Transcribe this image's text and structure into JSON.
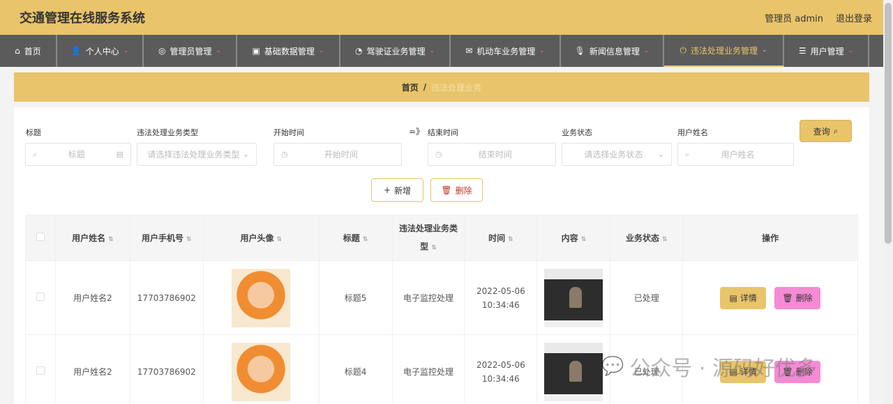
{
  "header": {
    "title": "交通管理在线服务系统",
    "user": "管理员 admin",
    "logout": "退出登录"
  },
  "nav": [
    {
      "label": "首页",
      "icon": "home-icon",
      "chevron": false
    },
    {
      "label": "个人中心",
      "icon": "user-icon",
      "chevron": true
    },
    {
      "label": "管理员管理",
      "icon": "admin-icon",
      "chevron": true
    },
    {
      "label": "基础数据管理",
      "icon": "data-icon",
      "chevron": true
    },
    {
      "label": "驾驶证业务管理",
      "icon": "license-icon",
      "chevron": true
    },
    {
      "label": "机动车业务管理",
      "icon": "mail-icon",
      "chevron": true
    },
    {
      "label": "新闻信息管理",
      "icon": "mic-icon",
      "chevron": true
    },
    {
      "label": "违法处理业务管理",
      "icon": "power-icon",
      "chevron": true,
      "active": true
    },
    {
      "label": "用户管理",
      "icon": "list-icon",
      "chevron": true
    }
  ],
  "breadcrumb": {
    "home": "首页",
    "sep": "/",
    "current": "违法处理业务"
  },
  "filters": {
    "title_label": "标题",
    "title_placeholder": "标题",
    "type_label": "违法处理业务类型",
    "type_placeholder": "请选择违法处理业务类型",
    "start_label": "开始时间",
    "start_placeholder": "开始时间",
    "range_sep": "=》",
    "end_label": "结束时间",
    "end_placeholder": "结束时间",
    "status_label": "业务状态",
    "status_placeholder": "请选择业务状态",
    "username_label": "用户姓名",
    "username_placeholder": "用户姓名",
    "query": "查询"
  },
  "actions": {
    "add": "新增",
    "delete": "删除"
  },
  "table": {
    "headers": [
      "用户姓名",
      "用户手机号",
      "用户头像",
      "标题",
      "违法处理业务类型",
      "时间",
      "内容",
      "业务状态",
      "操作"
    ],
    "rows": [
      {
        "name": "用户姓名2",
        "phone": "17703786902",
        "title": "标题5",
        "type": "电子监控处理",
        "time": "2022-05-06 10:34:46",
        "status": "已处理"
      },
      {
        "name": "用户姓名2",
        "phone": "17703786902",
        "title": "标题4",
        "type": "电子监控处理",
        "time": "2022-05-06 10:34:46",
        "status": "已处理"
      }
    ],
    "detail": "详情",
    "delete": "删除"
  },
  "watermark": "公众号 · 源码好优多"
}
